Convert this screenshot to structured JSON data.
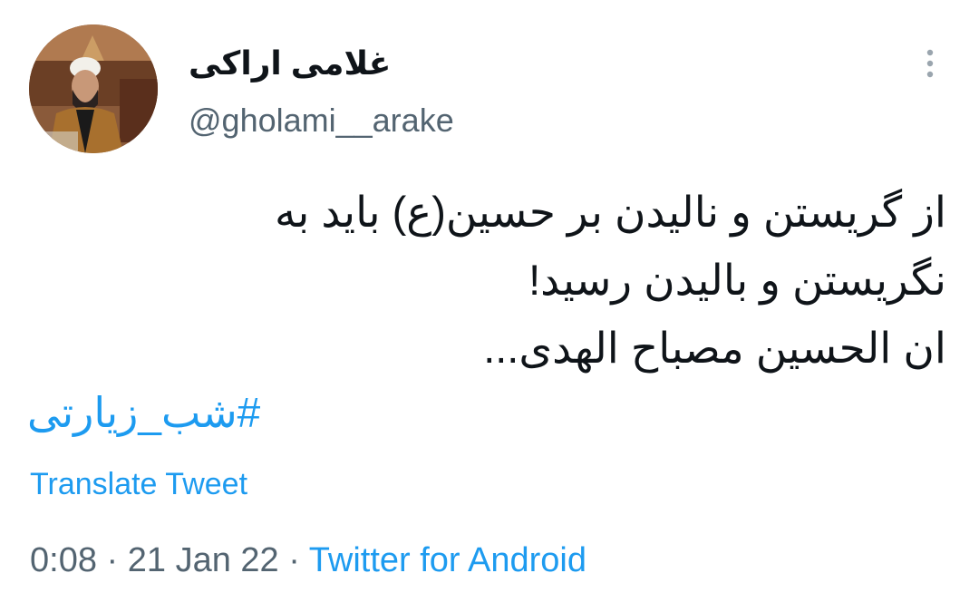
{
  "user": {
    "display_name": "غلامی اراکی",
    "handle": "@gholami__arake"
  },
  "tweet": {
    "lines": [
      "از گریستن و نالیدن بر حسین(ع) باید به",
      "نگریستن و بالیدن رسید!",
      "ان الحسین مصباح الهدی..."
    ],
    "hashtag": "#شب_زیارتی",
    "translate_label": "Translate Tweet",
    "time": "0:08",
    "separator": "·",
    "date": "21 Jan 22",
    "source": "Twitter for Android"
  },
  "icons": {
    "more": "more-vertical-icon",
    "avatar": "profile-photo"
  },
  "colors": {
    "link": "#1d9bf0",
    "text": "#0f1419",
    "secondary": "#536471"
  }
}
